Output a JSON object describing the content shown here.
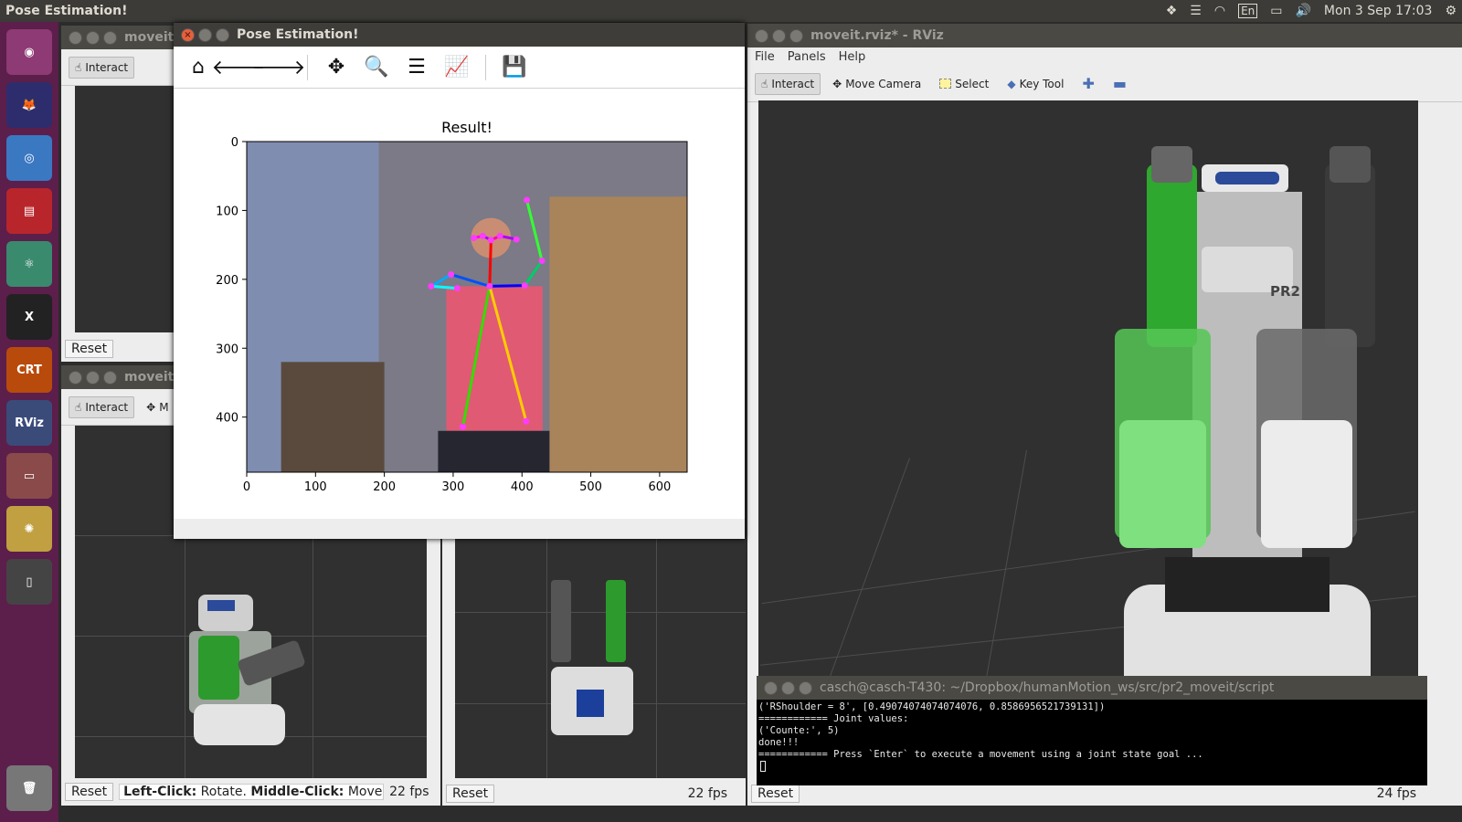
{
  "topbar": {
    "app_title": "Pose Estimation!",
    "keyboard": "En",
    "clock": "Mon  3 Sep 17:03"
  },
  "launcher": {
    "items": [
      {
        "name": "ubuntu-dash-icon",
        "glyph": "◉",
        "color": "#8e3a74"
      },
      {
        "name": "firefox-icon",
        "glyph": "🦊",
        "color": "#2d2d6e"
      },
      {
        "name": "chrome-icon",
        "glyph": "◎",
        "color": "#3b78c2"
      },
      {
        "name": "terminal-red-icon",
        "glyph": "▤",
        "color": "#b8262b"
      },
      {
        "name": "atom-icon",
        "glyph": "⚛",
        "color": "#3a8a6e"
      },
      {
        "name": "xterm-icon",
        "glyph": "X",
        "color": "#222222"
      },
      {
        "name": "crt-icon",
        "glyph": "CRT",
        "color": "#b84a0c"
      },
      {
        "name": "rviz-icon",
        "glyph": "RViz",
        "color": "#3a4b7a"
      },
      {
        "name": "files-icon",
        "glyph": "▭",
        "color": "#8a4a4a"
      },
      {
        "name": "kazam-icon",
        "glyph": "✺",
        "color": "#c0a040"
      },
      {
        "name": "phone-icon",
        "glyph": "▯",
        "color": "#444444"
      },
      {
        "name": "trash-icon",
        "glyph": "🗑",
        "color": "#777777"
      }
    ]
  },
  "left_windows": {
    "title1": "moveit",
    "title2": "moveit",
    "interact": "Interact",
    "move_short": "M",
    "reset": "Reset",
    "status_left_click": "Left-Click:",
    "status_rotate": "Rotate.",
    "status_middle_click": "Middle-Click:",
    "status_move": "Move X/Y",
    "fps_left": "22 fps",
    "fps_mid": "22 fps"
  },
  "rviz": {
    "title": "moveit.rviz* - RViz",
    "menu": [
      "File",
      "Panels",
      "Help"
    ],
    "tools": {
      "interact": "Interact",
      "move_camera": "Move Camera",
      "select": "Select",
      "key_tool": "Key Tool"
    },
    "robot_label": "PR2",
    "reset": "Reset",
    "fps": "24 fps"
  },
  "terminal": {
    "title": "casch@casch-T430: ~/Dropbox/humanMotion_ws/src/pr2_moveit/script",
    "lines": [
      "('RShoulder = 8', [0.49074074074074076, 0.8586956521739131])",
      "============ Joint values:",
      "('Counte:', 5)",
      "done!!!",
      "",
      "============ Press `Enter` to execute a movement using a joint state goal ..."
    ]
  },
  "plot_window": {
    "title": "Pose Estimation!",
    "toolbar": [
      "home-icon",
      "back-arrow-icon",
      "forward-arrow-icon",
      "pan-icon",
      "zoom-icon",
      "configure-subplots-icon",
      "edit-axis-icon",
      "save-icon"
    ]
  },
  "chart_data": {
    "type": "image",
    "title": "Result!",
    "xlabel": "",
    "ylabel": "",
    "xlim": [
      0,
      640
    ],
    "ylim": [
      480,
      0
    ],
    "xticks": [
      0,
      100,
      200,
      300,
      400,
      500,
      600
    ],
    "yticks": [
      0,
      100,
      200,
      300,
      400
    ],
    "keypoints": [
      {
        "name": "nose",
        "x": 355,
        "y": 143
      },
      {
        "name": "neck",
        "x": 353,
        "y": 210
      },
      {
        "name": "r_eye",
        "x": 343,
        "y": 137
      },
      {
        "name": "l_eye",
        "x": 368,
        "y": 137
      },
      {
        "name": "r_ear",
        "x": 330,
        "y": 140
      },
      {
        "name": "l_ear",
        "x": 392,
        "y": 142
      },
      {
        "name": "r_shoulder",
        "x": 297,
        "y": 193
      },
      {
        "name": "r_elbow",
        "x": 268,
        "y": 210
      },
      {
        "name": "r_wrist",
        "x": 306,
        "y": 213
      },
      {
        "name": "l_shoulder",
        "x": 404,
        "y": 209
      },
      {
        "name": "l_elbow",
        "x": 429,
        "y": 173
      },
      {
        "name": "l_wrist",
        "x": 407,
        "y": 85
      },
      {
        "name": "r_hip",
        "x": 314,
        "y": 414
      },
      {
        "name": "l_hip",
        "x": 406,
        "y": 406
      }
    ],
    "limbs": [
      {
        "a": "neck",
        "b": "nose",
        "color": "#ff0000"
      },
      {
        "a": "nose",
        "b": "r_eye",
        "color": "#aa00ff"
      },
      {
        "a": "nose",
        "b": "l_eye",
        "color": "#ff00aa"
      },
      {
        "a": "r_eye",
        "b": "r_ear",
        "color": "#ff00ff"
      },
      {
        "a": "l_eye",
        "b": "l_ear",
        "color": "#aa00ff"
      },
      {
        "a": "neck",
        "b": "r_shoulder",
        "color": "#0050ff"
      },
      {
        "a": "r_shoulder",
        "b": "r_elbow",
        "color": "#00aaff"
      },
      {
        "a": "r_elbow",
        "b": "r_wrist",
        "color": "#00ffff"
      },
      {
        "a": "neck",
        "b": "l_shoulder",
        "color": "#0000ff"
      },
      {
        "a": "l_shoulder",
        "b": "l_elbow",
        "color": "#00cc66"
      },
      {
        "a": "l_elbow",
        "b": "l_wrist",
        "color": "#33ff33"
      },
      {
        "a": "neck",
        "b": "r_hip",
        "color": "#33dd00"
      },
      {
        "a": "neck",
        "b": "l_hip",
        "color": "#ffcc00"
      }
    ]
  }
}
